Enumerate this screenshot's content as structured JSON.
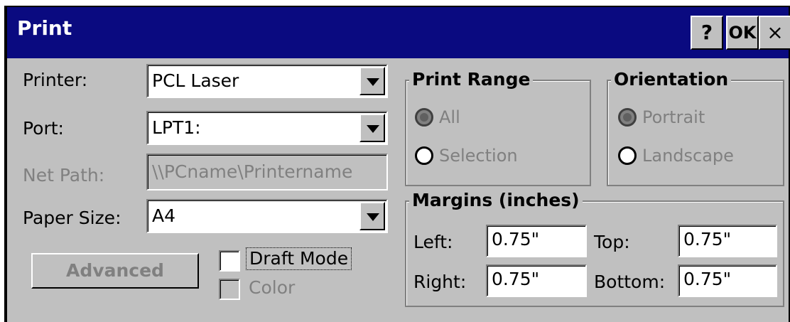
{
  "window": {
    "title": "Print"
  },
  "titlebar_buttons": {
    "help": "?",
    "ok": "OK",
    "close": "×"
  },
  "fields": {
    "printer": {
      "label": "Printer:",
      "value": "PCL Laser"
    },
    "port": {
      "label": "Port:",
      "value": "LPT1:"
    },
    "net_path": {
      "label": "Net Path:",
      "value": "\\\\PCname\\Printername"
    },
    "paper_size": {
      "label": "Paper Size:",
      "value": "A4"
    }
  },
  "print_range": {
    "title": "Print Range",
    "options": [
      {
        "label": "All",
        "selected": true
      },
      {
        "label": "Selection",
        "selected": false
      }
    ]
  },
  "orientation": {
    "title": "Orientation",
    "options": [
      {
        "label": "Portrait",
        "selected": true
      },
      {
        "label": "Landscape",
        "selected": false
      }
    ]
  },
  "margins": {
    "title": "Margins (inches)",
    "left": {
      "label": "Left:",
      "value": "0.75\""
    },
    "top": {
      "label": "Top:",
      "value": "0.75\""
    },
    "right": {
      "label": "Right:",
      "value": "0.75\""
    },
    "bottom": {
      "label": "Bottom:",
      "value": "0.75\""
    }
  },
  "options": {
    "advanced_label": "Advanced",
    "draft_mode_label": "Draft Mode",
    "color_label": "Color"
  },
  "colors": {
    "titlebar": "#0a0a80",
    "dialog": "#c0c0c0",
    "disabled": "#808080"
  }
}
